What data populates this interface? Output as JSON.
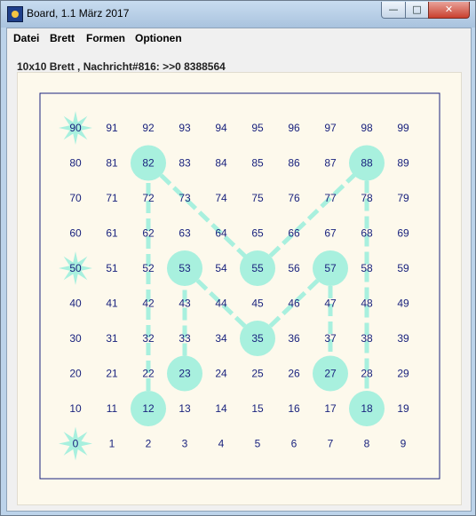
{
  "window": {
    "title": "Board, 1.1 März 2017",
    "controls": {
      "minimize": "—",
      "maximize": "□",
      "close": "✕"
    }
  },
  "menu": [
    "Datei",
    "Brett",
    "Formen",
    "Optionen"
  ],
  "status": "10x10 Brett , Nachricht#816: >>0 8388564",
  "board": {
    "size": 10,
    "highlighted_circles": [
      12,
      18,
      23,
      27,
      35,
      53,
      55,
      57,
      82,
      88
    ],
    "star_cells": [
      0,
      50,
      90
    ],
    "dashed_paths": [
      [
        12,
        82
      ],
      [
        82,
        55
      ],
      [
        55,
        88
      ],
      [
        88,
        18
      ],
      [
        23,
        53
      ],
      [
        53,
        35
      ],
      [
        35,
        57
      ],
      [
        57,
        27
      ]
    ],
    "colors": {
      "cell_number": "#1a237e",
      "highlight": "#a8f0de",
      "path": "#a8f0de",
      "frame": "#1a237e",
      "panel_bg": "#fdf9ec"
    }
  }
}
